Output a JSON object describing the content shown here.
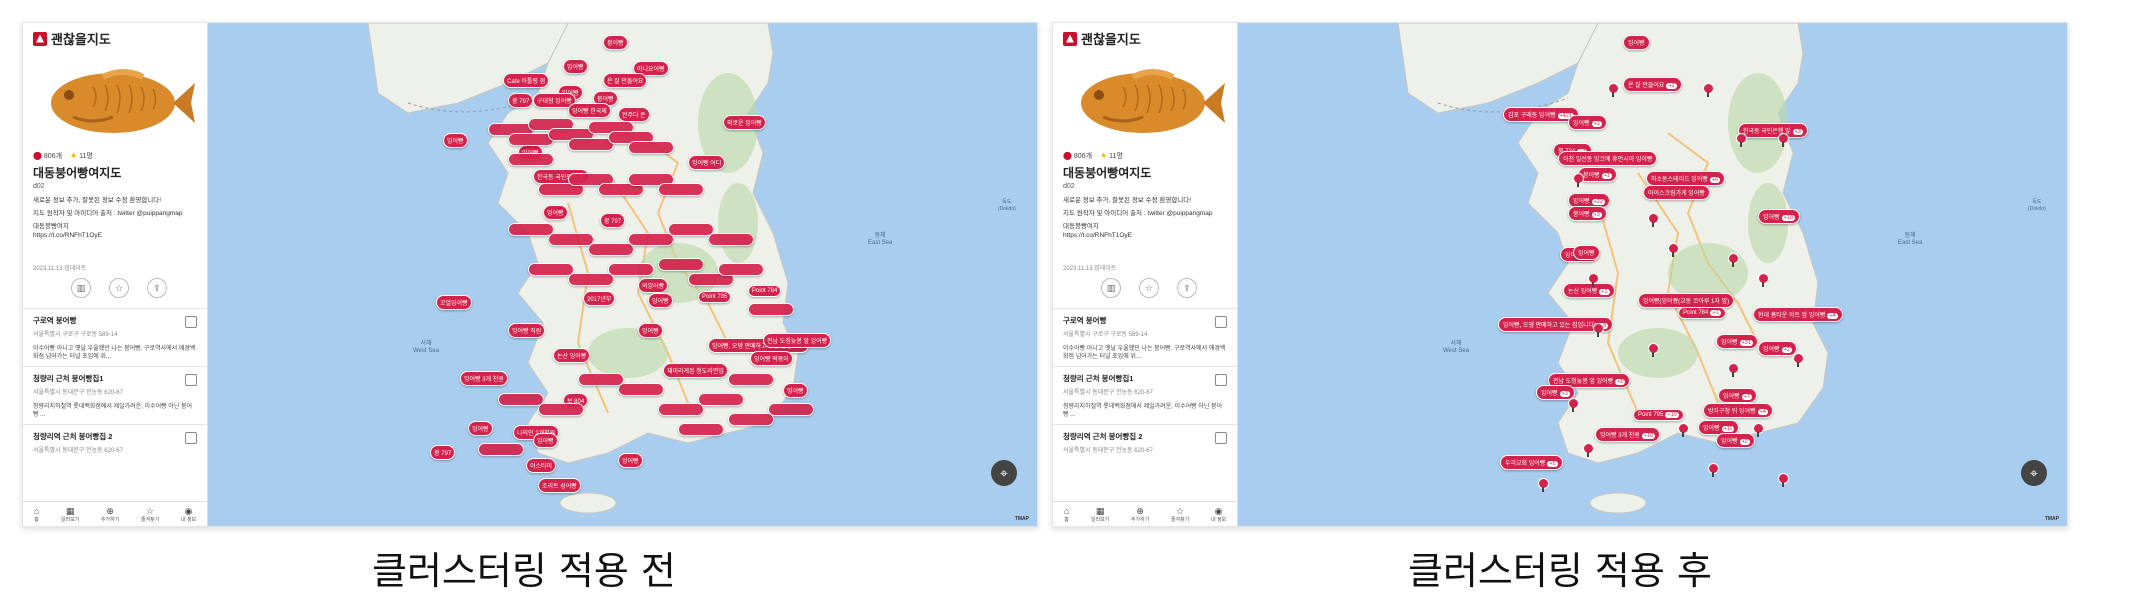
{
  "app": {
    "logo_text": "괜찮을지도"
  },
  "place": {
    "pin_count": "806개",
    "star_count": "11명",
    "title": "대동붕어빵여지도",
    "author": "d02",
    "desc1": "새로운 정보 추가, 잘못된 정보 수정 환영합니다!",
    "desc2": "지도 원작자 및 아이디어 출처 : twitter @puippangmap",
    "desc3": "대동붕빵여지",
    "desc4": "https://t.co/RNFhT1OyE",
    "date": "2023.11.13 업데이트"
  },
  "list": [
    {
      "title": "구로역 붕어빵",
      "addr": "서울특별시 구로구 구로동 589-14",
      "desc": "이수어빵 아니고 옛날 우울했던 나는 붕어빵. 구로역사에서 애경백화점 넘어가는 터널 초입에 위..."
    },
    {
      "title": "청량리 근처 붕어빵집1",
      "addr": "서울특별시 동대문구 전농동 620-67",
      "desc": "청량리지하철역 롯데백화점에서 제일가려운, 이수어빵 아닌 붕어빵 ..."
    },
    {
      "title": "청량리역 근처 붕어빵집 2",
      "addr": "서울특별시 동대문구 전농동 620-67",
      "desc": ""
    }
  ],
  "nav": [
    {
      "icon": "home-icon",
      "glyph": "⌂",
      "label": "홈"
    },
    {
      "icon": "map-icon",
      "glyph": "▦",
      "label": "일러보기"
    },
    {
      "icon": "add-icon",
      "glyph": "⊕",
      "label": "추가하기"
    },
    {
      "icon": "star-icon",
      "glyph": "☆",
      "label": "즐겨찾기"
    },
    {
      "icon": "user-icon",
      "glyph": "◉",
      "label": "내 정보"
    }
  ],
  "map": {
    "west_sea": "서해\nWest Sea",
    "east_sea": "동해\nEast Sea",
    "credit": "TMAP",
    "dokdo": "독도\n(Dokdo)"
  },
  "before_pins": [
    "붕어빵",
    "잉어빵",
    "아니요어빵",
    "Cafe 아틀링 점",
    "온 잘 만들어요",
    "잉어빵",
    "붕 797",
    "구대형 잉어빵",
    "붕어빵",
    "잉어빵 한국제",
    "전주다 돈",
    "외로운 잉어빵",
    "잉어빵",
    "잉어빵",
    "잉어빵 어디",
    "한국동 국민은행 앞",
    "잉어빵",
    "붕 797",
    "의잉어빵",
    "잉어빵",
    "Point 785",
    "Point 784",
    "2017년부",
    "꼬얼잉어빵",
    "잉어빵 직원",
    "논산 잉어빵",
    "잉어빵, 오뎅 판매하고 있는 집입니다!",
    "잉어빵 떡볶이",
    "전남 도청늦봉 앞 잉어빵",
    "잉어빵 3개 천원",
    "보 804",
    "나의인 2개천원",
    "잉어빵",
    "잉어빵",
    "이스타이",
    "붕 797",
    "잉어빵",
    "조리트 성어빵",
    "재미라게된 청도라면입",
    "잉어빵",
    "잉어빵"
  ],
  "after_pins": [
    {
      "label": "잉어빵",
      "badge": ""
    },
    {
      "label": "온 잘 만들어요",
      "badge": "+2"
    },
    {
      "label": "김포 구래동 잉어빵",
      "badge": "+421"
    },
    {
      "label": "잉어빵",
      "badge": "+1"
    },
    {
      "label": "붕 724",
      "badge": "+2"
    },
    {
      "label": "한국동 국민은행 앞",
      "badge": "+3"
    },
    {
      "label": "이천 일선동 잉크에 휴먼시아 잉어빵",
      "badge": ""
    },
    {
      "label": "붕어빵",
      "badge": "+1"
    },
    {
      "label": "하소동스테이드 잉어빵",
      "badge": "+6"
    },
    {
      "label": "잉어빵",
      "badge": "+22"
    },
    {
      "label": "아이스크림가게 잉어빵",
      "badge": ""
    },
    {
      "label": "붕어빵",
      "badge": "+3"
    },
    {
      "label": "잉어빵",
      "badge": "+10"
    },
    {
      "label": "잉어빵",
      "badge": "+3"
    },
    {
      "label": "잉어빵",
      "badge": ""
    },
    {
      "label": "논산 잉어빵",
      "badge": "+1"
    },
    {
      "label": "잉어빵(잉어빵(교동 코아루 1차 앞)",
      "badge": ""
    },
    {
      "label": "Point 784",
      "badge": "+1"
    },
    {
      "label": "현대 홈타운 아트 앞 잉어빵",
      "badge": "+4"
    },
    {
      "label": "잉어빵, 오뎅 판매하고 있는 집입니다!",
      "badge": "+8"
    },
    {
      "label": "잉어빵",
      "badge": "+31"
    },
    {
      "label": "잉어빵",
      "badge": "+2"
    },
    {
      "label": "잉어빵",
      "badge": "+7"
    },
    {
      "label": "전남 도청늦봉 앞 잉어빵",
      "badge": "+5"
    },
    {
      "label": "잉어빵",
      "badge": "+3"
    },
    {
      "label": "방자구청 뒤 잉어빵",
      "badge": "+4"
    },
    {
      "label": "Point 795",
      "badge": "+10"
    },
    {
      "label": "잉어빵",
      "badge": "+11"
    },
    {
      "label": "잉어빵 3개 천원",
      "badge": "+10"
    },
    {
      "label": "잉어빵",
      "badge": "+2"
    },
    {
      "label": "우리교회 잉어빵",
      "badge": "+5"
    }
  ],
  "captions": {
    "before": "클러스터링 적용 전",
    "after": "클러스터링 적용 후"
  }
}
